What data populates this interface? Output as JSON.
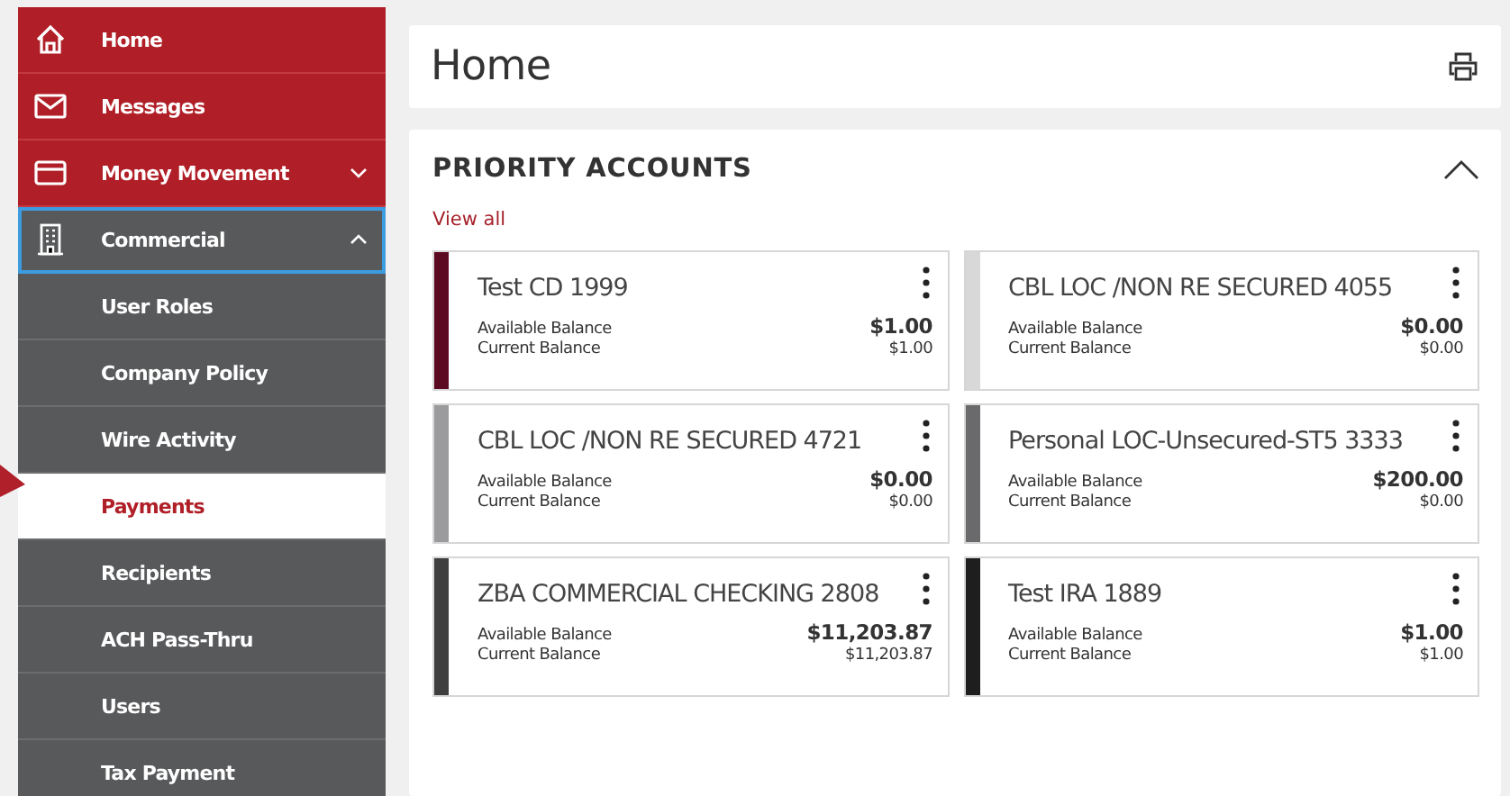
{
  "sidebar": {
    "items": [
      {
        "kind": "main",
        "label": "Home",
        "selected": false,
        "focused": false
      },
      {
        "kind": "main",
        "label": "Messages",
        "selected": false,
        "focused": false
      },
      {
        "kind": "group",
        "label": "Money Movement",
        "expanded": false,
        "focused": false
      },
      {
        "kind": "group",
        "label": "Commercial",
        "expanded": true,
        "focused": true,
        "children": [
          {
            "label": "User Roles",
            "selected": false
          },
          {
            "label": "Company Policy",
            "selected": false
          },
          {
            "label": "Wire Activity",
            "selected": false
          },
          {
            "label": "Payments",
            "selected": true
          },
          {
            "label": "Recipients",
            "selected": false
          },
          {
            "label": "ACH Pass-Thru",
            "selected": false
          },
          {
            "label": "Users",
            "selected": false
          },
          {
            "label": "Tax Payment",
            "selected": false
          }
        ]
      }
    ]
  },
  "header": {
    "title": "Home"
  },
  "priority_accounts": {
    "title": "PRIORITY ACCOUNTS",
    "expanded": true,
    "view_all": "View all",
    "accounts": [
      {
        "name": "Test CD 1999",
        "color": "#5c0a22",
        "available_label": "Available Balance",
        "available": "$1.00",
        "current_label": "Current Balance",
        "current": "$1.00"
      },
      {
        "name": "CBL LOC /NON RE SECURED 4055",
        "color": "#d8d8d8",
        "available_label": "Available Balance",
        "available": "$0.00",
        "current_label": "Current Balance",
        "current": "$0.00"
      },
      {
        "name": "CBL LOC /NON RE SECURED 4721",
        "color": "#9b9b9d",
        "available_label": "Available Balance",
        "available": "$0.00",
        "current_label": "Current Balance",
        "current": "$0.00"
      },
      {
        "name": "Personal LOC-Unsecured-ST5 3333",
        "color": "#6a6a6c",
        "available_label": "Available Balance",
        "available": "$200.00",
        "current_label": "Current Balance",
        "current": "$0.00"
      },
      {
        "name": "ZBA COMMERCIAL CHECKING 2808",
        "color": "#3e3e3e",
        "available_label": "Available Balance",
        "available": "$11,203.87",
        "current_label": "Current Balance",
        "current": "$11,203.87"
      },
      {
        "name": "Test IRA 1889",
        "color": "#1e1e1e",
        "available_label": "Available Balance",
        "available": "$1.00",
        "current_label": "Current Balance",
        "current": "$1.00"
      }
    ]
  }
}
